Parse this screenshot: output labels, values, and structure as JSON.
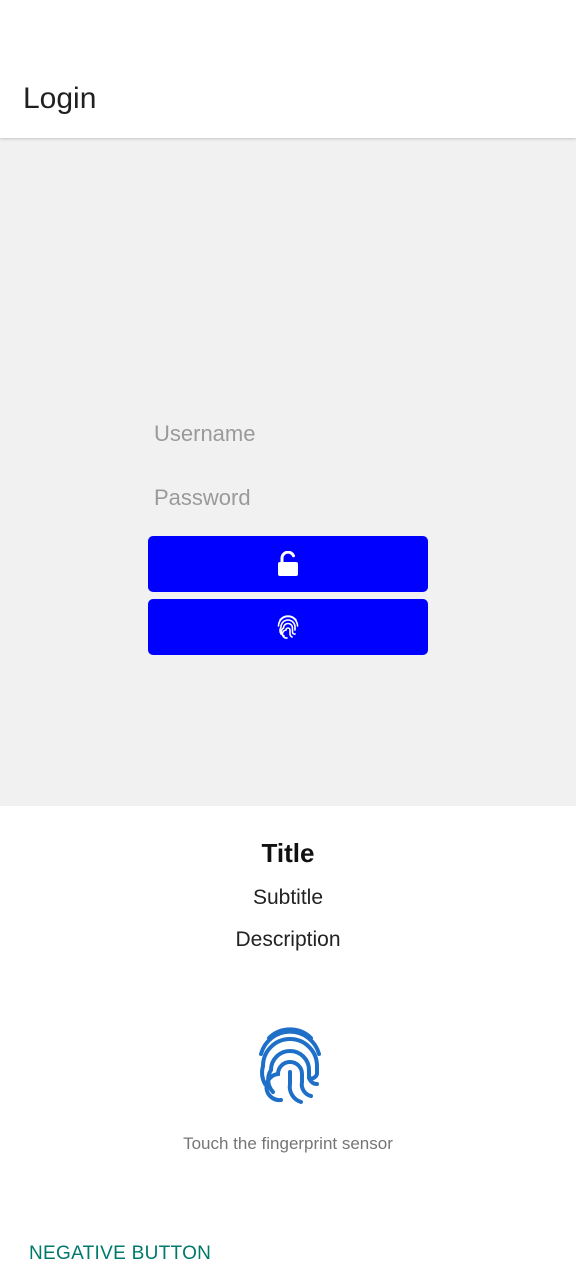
{
  "app_bar": {
    "title": "Login"
  },
  "login_form": {
    "username_placeholder": "Username",
    "password_placeholder": "Password",
    "unlock_button_icon": "unlock-icon",
    "fingerprint_button_icon": "fingerprint-icon",
    "button_color": "#0000ff"
  },
  "biometric_prompt": {
    "title": "Title",
    "subtitle": "Subtitle",
    "description": "Description",
    "icon": "fingerprint-icon",
    "icon_color": "#1e6fc8",
    "hint": "Touch the fingerprint sensor",
    "negative_button": "NEGATIVE BUTTON",
    "negative_button_color": "#00796b"
  }
}
